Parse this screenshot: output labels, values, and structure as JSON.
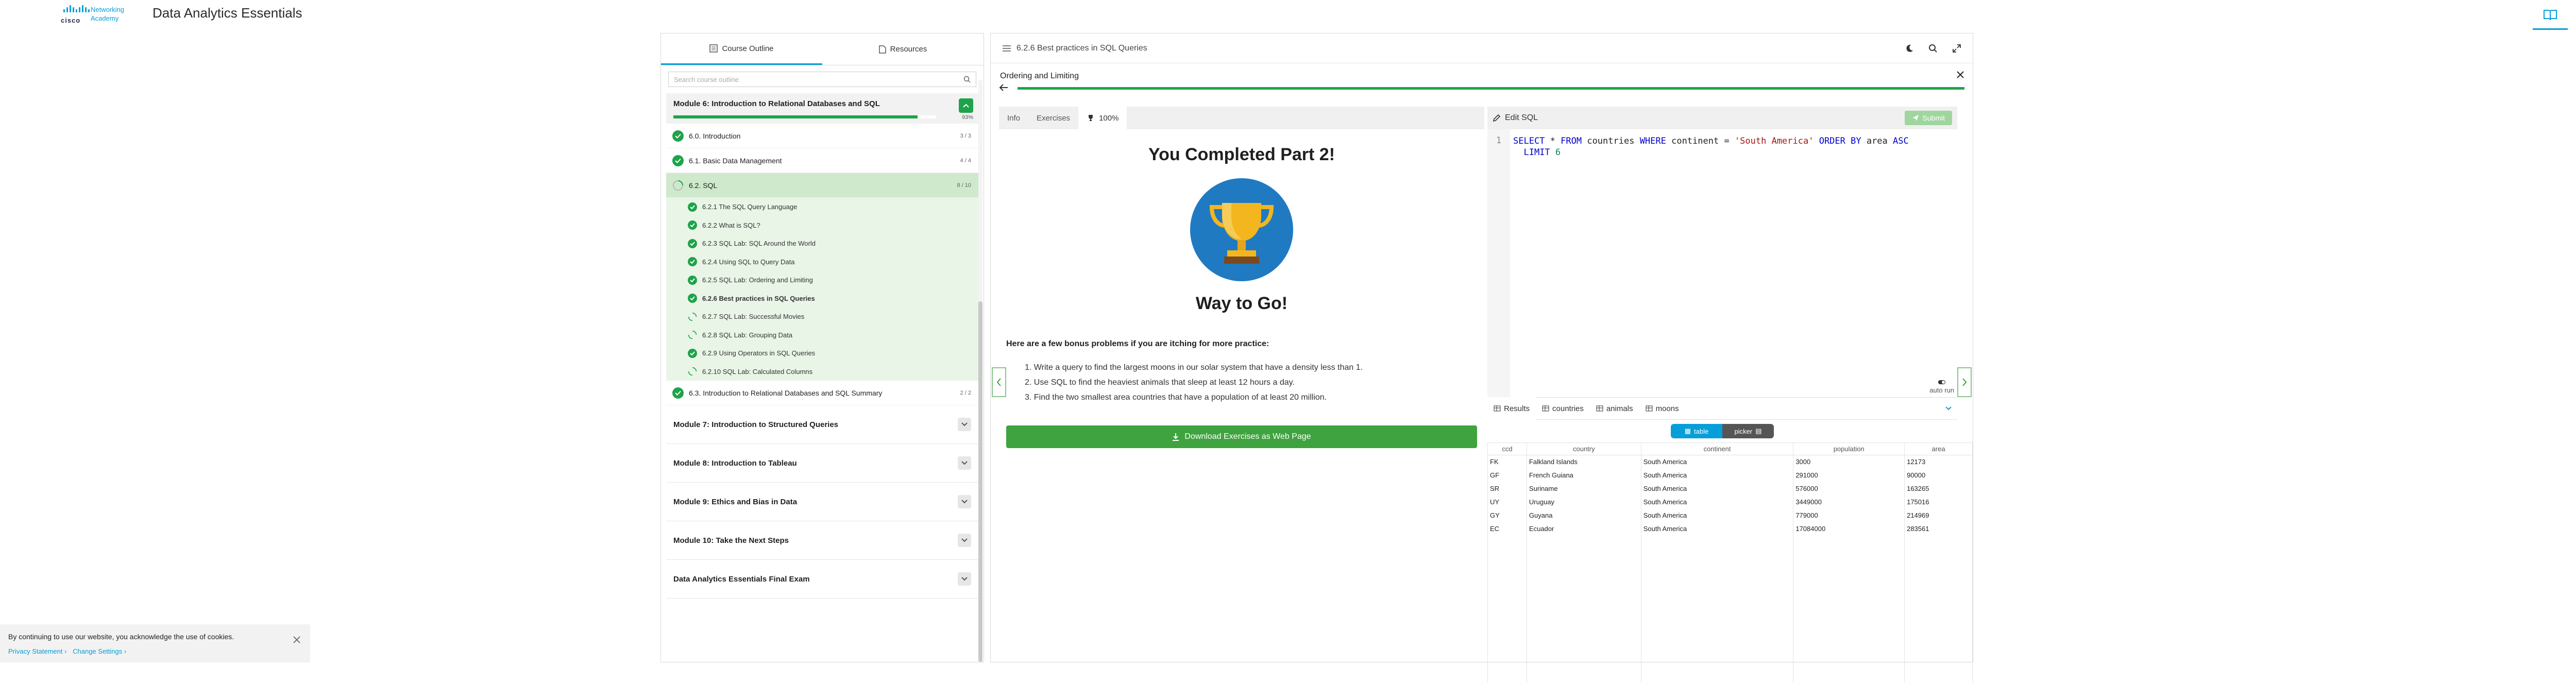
{
  "header": {
    "brand_line1": "Networking",
    "brand_line2": "Academy",
    "brand_word": "cisco",
    "title": "Data Analytics Essentials"
  },
  "sidebar": {
    "tabs": [
      "Course Outline",
      "Resources"
    ],
    "search_placeholder": "Search course outline",
    "module6": {
      "title": "Module 6: Introduction to Relational Databases and SQL",
      "progress_percent": 93,
      "progress_label": "93%"
    },
    "sections": [
      {
        "label": "6.0. Introduction",
        "count": "3 / 3"
      },
      {
        "label": "6.1. Basic Data Management",
        "count": "4 / 4"
      },
      {
        "label": "6.2. SQL",
        "count": "8 / 10"
      }
    ],
    "subitems": [
      {
        "label": "6.2.1 The SQL Query Language",
        "status": "done"
      },
      {
        "label": "6.2.2 What is SQL?",
        "status": "done"
      },
      {
        "label": "6.2.3 SQL Lab: SQL Around the World",
        "status": "done"
      },
      {
        "label": "6.2.4 Using SQL to Query Data",
        "status": "done"
      },
      {
        "label": "6.2.5 SQL Lab: Ordering and Limiting",
        "status": "done"
      },
      {
        "label": "6.2.6 Best practices in SQL Queries",
        "status": "current"
      },
      {
        "label": "6.2.7 SQL Lab: Successful Movies",
        "status": "partial"
      },
      {
        "label": "6.2.8 SQL Lab: Grouping Data",
        "status": "partial"
      },
      {
        "label": "6.2.9 Using Operators in SQL Queries",
        "status": "done"
      },
      {
        "label": "6.2.10 SQL Lab: Calculated Columns",
        "status": "partial"
      }
    ],
    "section_summary": {
      "label": "6.3. Introduction to Relational Databases and SQL Summary",
      "count": "2 / 2"
    },
    "modules": [
      "Module 7: Introduction to Structured Queries",
      "Module 8: Introduction to Tableau",
      "Module 9: Ethics and Bias in Data",
      "Module 10: Take the Next Steps",
      "Data Analytics Essentials Final Exam"
    ]
  },
  "content": {
    "page_title": "6.2.6 Best practices in SQL Queries",
    "lab_title": "Ordering and Limiting",
    "left_tabs": [
      "Info",
      "Exercises",
      "100%"
    ],
    "completed": "You Completed Part 2!",
    "way_to_go": "Way to Go!",
    "bonus_intro": "Here are a few bonus problems if you are itching for more practice:",
    "bonus": [
      "Write a query to find the largest moons in our solar system that have a density less than 1.",
      "Use SQL to find the heaviest animals that sleep at least 12 hours a day.",
      "Find the two smallest area countries that have a population of at least 20 million."
    ],
    "download_label": "Download Exercises as Web Page",
    "edit_sql": "Edit SQL",
    "submit": "Submit",
    "line_number": "1",
    "code": {
      "select": "SELECT",
      "star": " * ",
      "from": "FROM",
      "table": " countries ",
      "where": "WHERE",
      "cond": " continent = ",
      "val": "'South America'",
      "order": " ORDER BY",
      "col": " area ",
      "asc": "ASC",
      "limit": "LIMIT",
      "n": " 6"
    },
    "autorun": "auto run",
    "result_tabs": [
      "Results",
      "countries",
      "animals",
      "moons"
    ],
    "view_toggle": [
      "table",
      "picker"
    ],
    "columns": [
      "ccd",
      "country",
      "continent",
      "population",
      "area"
    ],
    "rows": [
      [
        "FK",
        "Falkland Islands",
        "South America",
        "3000",
        "12173"
      ],
      [
        "GF",
        "French Guiana",
        "South America",
        "291000",
        "90000"
      ],
      [
        "SR",
        "Suriname",
        "South America",
        "576000",
        "163265"
      ],
      [
        "UY",
        "Uruguay",
        "South America",
        "3449000",
        "175016"
      ],
      [
        "GY",
        "Guyana",
        "South America",
        "779000",
        "214969"
      ],
      [
        "EC",
        "Ecuador",
        "South America",
        "17084000",
        "283561"
      ]
    ]
  },
  "cookie": {
    "text": "By continuing to use our website, you acknowledge the use of cookies.",
    "privacy": "Privacy Statement",
    "settings": "Change Settings"
  },
  "colors": {
    "accent": "#049fd9",
    "success": "#1ea34a",
    "download": "#3fa33f"
  }
}
